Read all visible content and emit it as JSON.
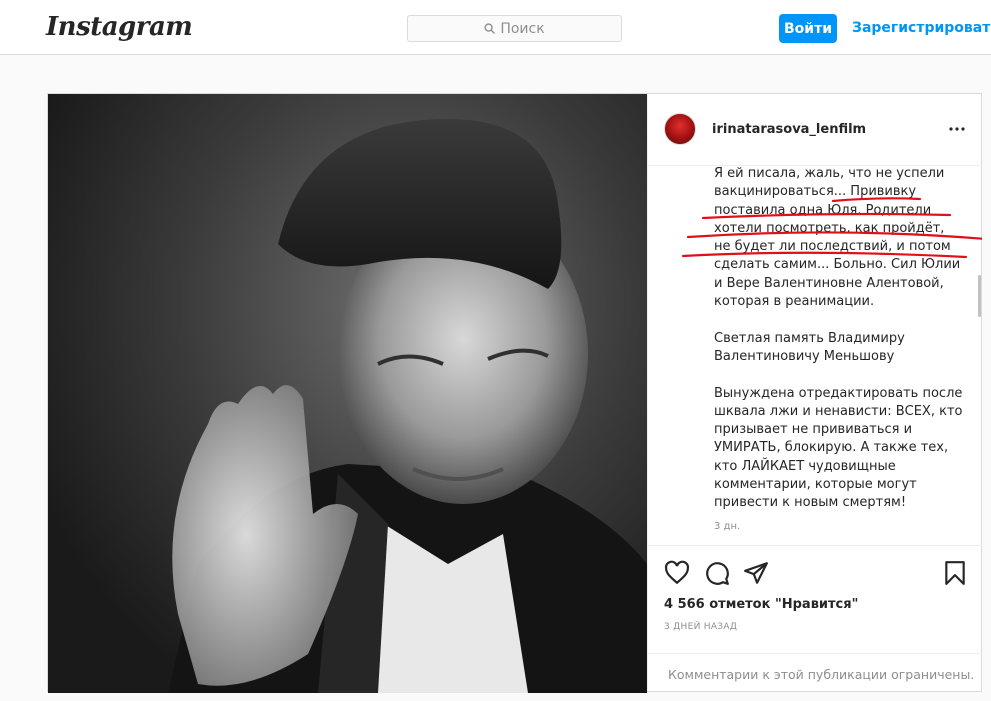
{
  "header": {
    "logo": "Instagram",
    "search_placeholder": "Поиск",
    "login_label": "Войти",
    "signup_label": "Зарегистрироваться"
  },
  "post": {
    "username": "irinatarasova_lenfilm",
    "caption": "Я ей писала, жаль, что не успели вакцинироваться... Прививку поставила одна Юля. Родители хотели посмотреть, как пройдёт, не будет ли последствий, и потом сделать самим... Больно. Сил Юлии и Вере Валентиновне Алентовой, которая в реанимации.\n\nСветлая память Владимиру Валентиновичу Меньшову\n\nВынуждена отредактировать после шквала лжи и ненависти: ВСЕХ, кто призывает не прививаться и УМИРАТЬ, блокирую. А также тех, кто ЛАЙКАЕТ чудовищные комментарии, которые могут привести к новым смертям!",
    "caption_age": "3 дн.",
    "likes": "4 566 отметок \"Нравится\"",
    "date": "3 ДНЕЙ НАЗАД",
    "comments_notice": "Комментарии к этой публикации ограничены."
  },
  "icons": {
    "search": "search-icon",
    "more": "more-horizontal-icon",
    "like": "heart-icon",
    "comment": "comment-icon",
    "share": "paper-plane-icon",
    "save": "bookmark-icon"
  },
  "colors": {
    "accent": "#0095f6",
    "annotation": "#e0101a"
  }
}
